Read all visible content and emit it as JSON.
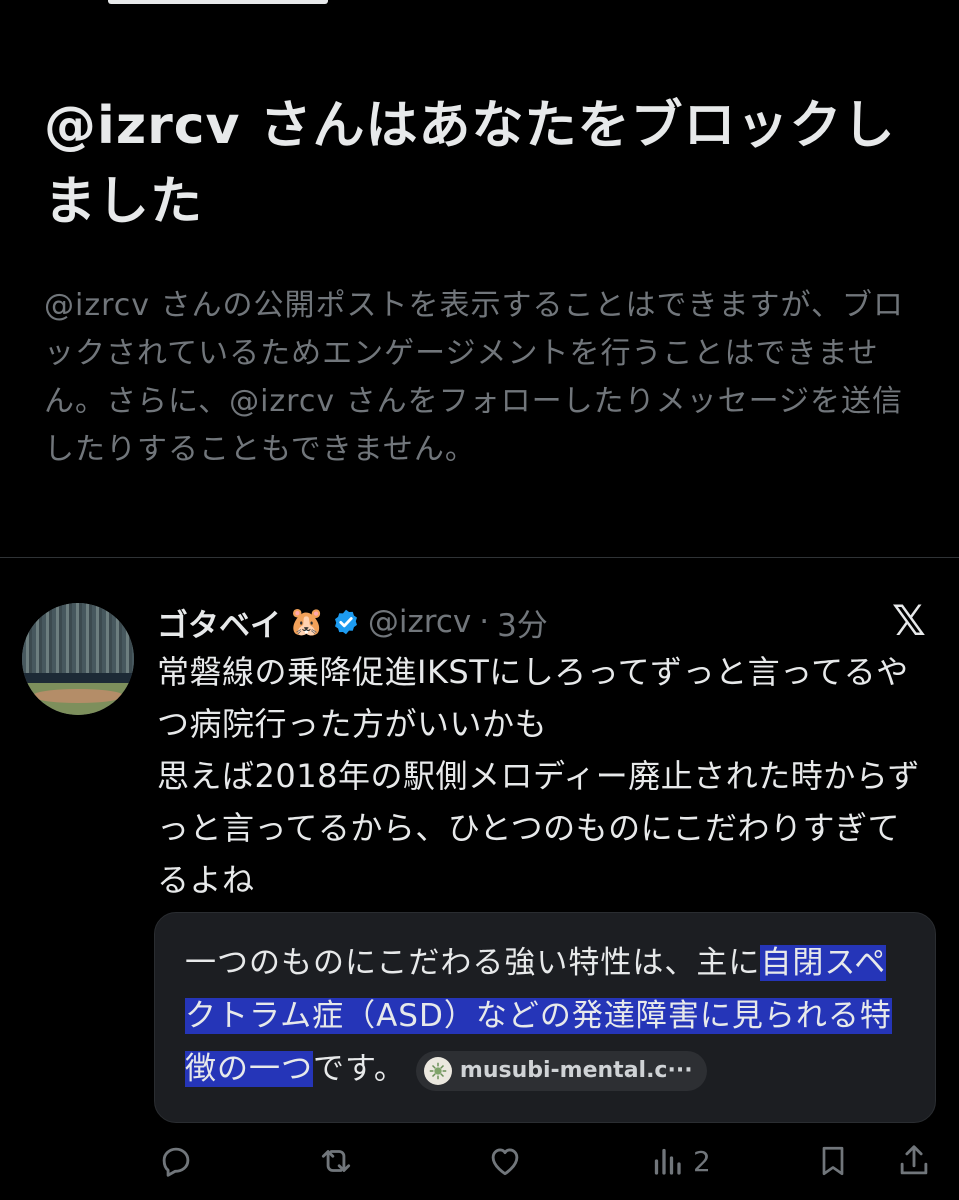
{
  "blocked_notice": {
    "title": "@izrcv さんはあなたをブロックしました",
    "description": "@izrcv さんの公開ポストを表示することはできますが、ブロックされているためエンゲージメントを行うことはできません。さらに、@izrcv さんをフォローしたりメッセージを送信したりすることもできません。"
  },
  "post": {
    "display_name": "ゴタベイ",
    "name_emoji": "🐹",
    "handle": "@izrcv",
    "separator": "·",
    "time": "3分",
    "platform_logo": "𝕏",
    "text": "常磐線の乗降促進IKSTにしろってずっと言ってるやつ病院行った方がいいかも\n思えば2018年の駅側メロディー廃止された時からずっと言ってるから、ひとつのものにこだわりすぎてるよね",
    "ai_card": {
      "text_plain": "一つのものにこだわる強い特性は、主に",
      "text_highlight_1": "自閉スペ",
      "text_highlight_2": "クトラム症（ASD）などの発達障害に見られる特",
      "text_highlight_3": "徴の一つ",
      "text_end": "です。",
      "source": "musubi-mental.c···"
    },
    "actions": {
      "reply_icon": "reply-icon",
      "repost_icon": "repost-icon",
      "like_icon": "like-icon",
      "views_count": "2",
      "bookmark_icon": "bookmark-icon",
      "share_icon": "share-icon"
    }
  },
  "colors": {
    "background": "#000000",
    "text_primary": "#e7e9ea",
    "text_secondary": "#71767b",
    "verified": "#1d9bf0",
    "highlight": "#2535b8",
    "card_bg": "#1c1e22"
  }
}
